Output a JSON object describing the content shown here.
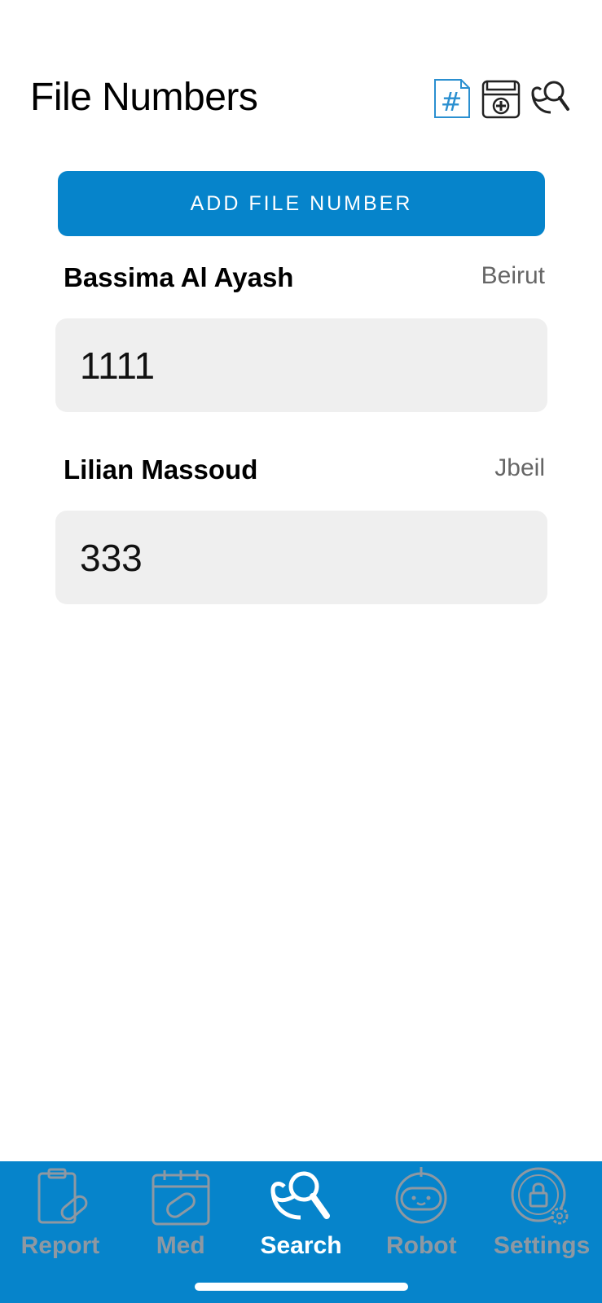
{
  "header": {
    "title": "File Numbers"
  },
  "actions": {
    "add_label": "ADD FILE NUMBER"
  },
  "entries": [
    {
      "name": "Bassima Al Ayash",
      "city": "Beirut",
      "file_number": "1111"
    },
    {
      "name": "Lilian Massoud",
      "city": "Jbeil",
      "file_number": "333"
    }
  ],
  "tabbar": {
    "active": "Search",
    "items": [
      {
        "label": "Report",
        "icon": "clipboard-pill-icon"
      },
      {
        "label": "Med",
        "icon": "calendar-pill-icon"
      },
      {
        "label": "Search",
        "icon": "stethoscope-search-icon"
      },
      {
        "label": "Robot",
        "icon": "robot-icon"
      },
      {
        "label": "Settings",
        "icon": "lock-gear-icon"
      }
    ]
  },
  "colors": {
    "accent": "#0684cb",
    "tab_inactive": "#8e98a2",
    "field_bg": "#efefef"
  }
}
